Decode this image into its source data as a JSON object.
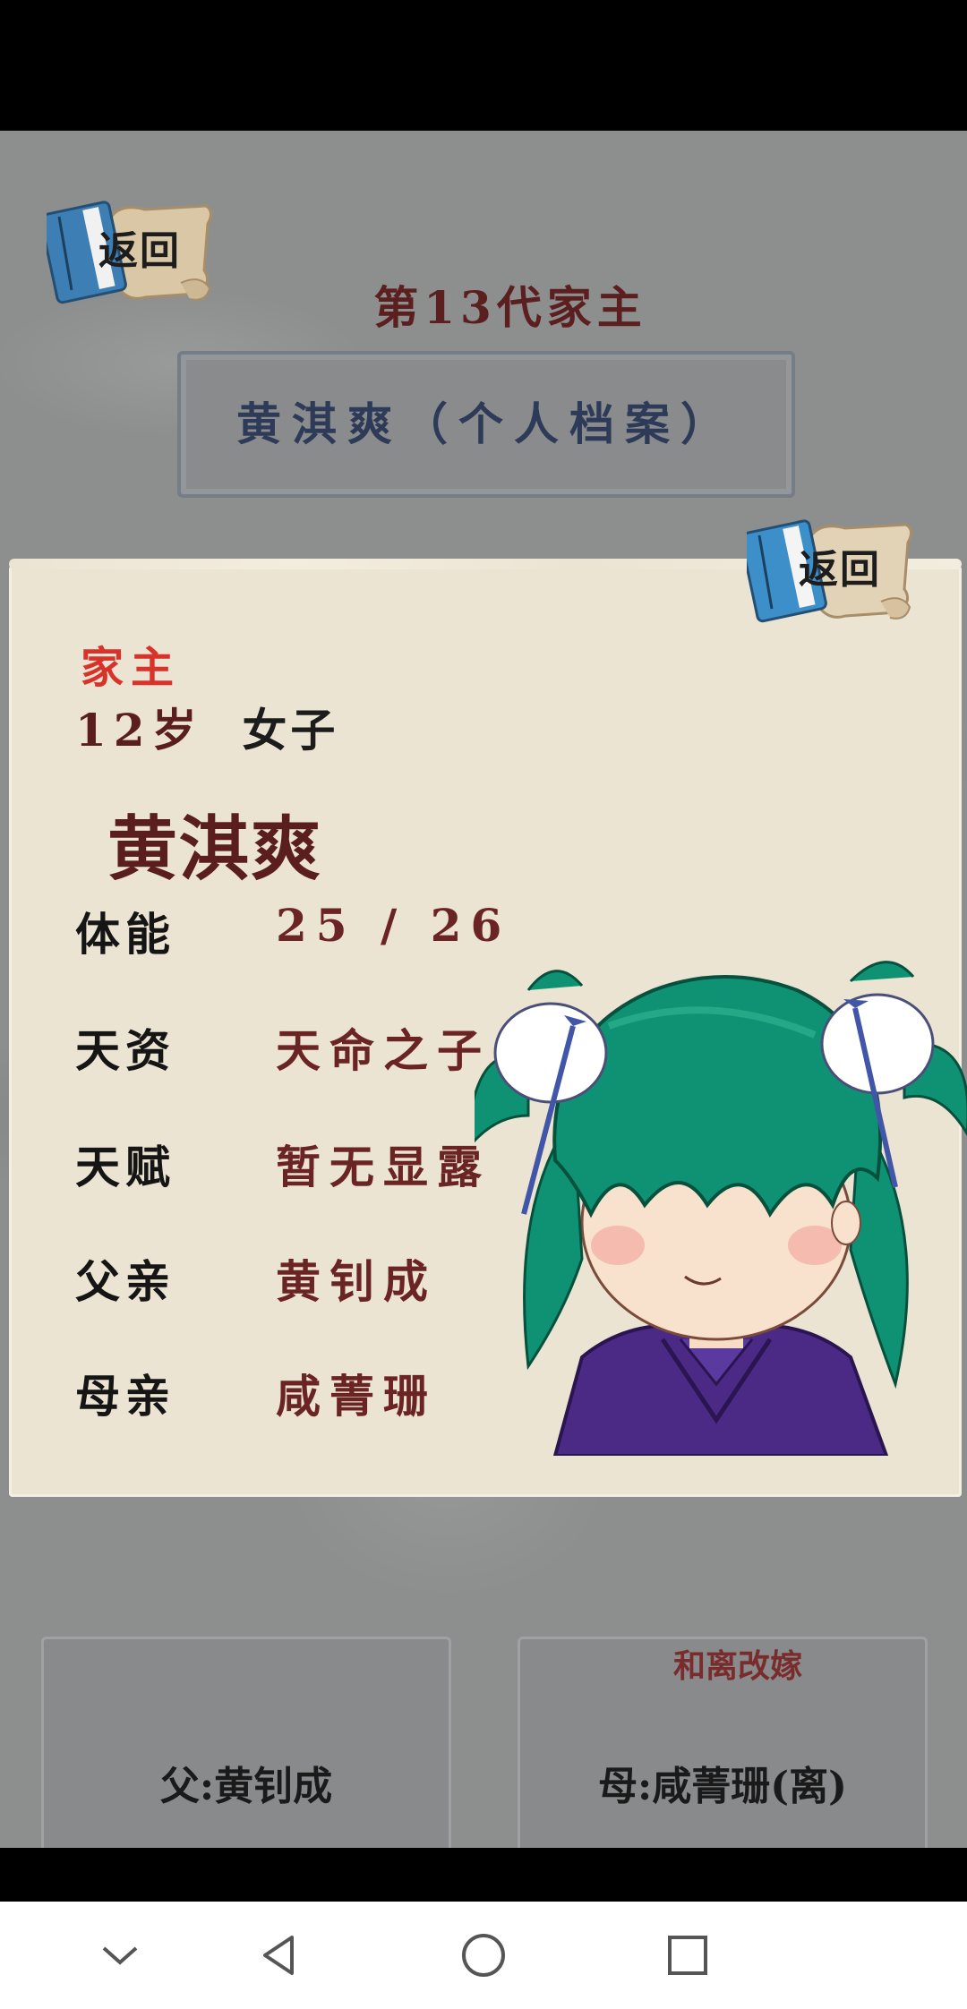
{
  "header": {
    "back_label": "返回",
    "generation_title": "第13代家主",
    "name_banner": "黄淇爽（个人档案）"
  },
  "profile": {
    "back_label": "返回",
    "role": "家主",
    "age": "12岁",
    "sex": "女子",
    "name": "黄淇爽",
    "stats": [
      {
        "label": "体能",
        "value": "25 / 26"
      },
      {
        "label": "天资",
        "value": "天命之子"
      },
      {
        "label": "天赋",
        "value": "暂无显露"
      },
      {
        "label": "父亲",
        "value": "黄钊成"
      },
      {
        "label": "母亲",
        "value": "咸菁珊"
      }
    ]
  },
  "actions": {
    "father_button": "父:黄钊成",
    "mother_button": "母:咸菁珊(离)",
    "remarry_link": "和离改嫁"
  },
  "colors": {
    "background": "#8d8f8f",
    "panel": "#ece4d2",
    "title_red": "#5c1f1f",
    "role_red": "#d8322b",
    "banner_text": "#2e3b58",
    "hair_green": "#0f9274",
    "robe_purple": "#4b2a86"
  },
  "icons": {
    "back": "book-scroll-icon",
    "nav_down": "chevron-down-icon",
    "nav_back": "triangle-back-icon",
    "nav_home": "circle-home-icon",
    "nav_recent": "square-recent-icon"
  }
}
